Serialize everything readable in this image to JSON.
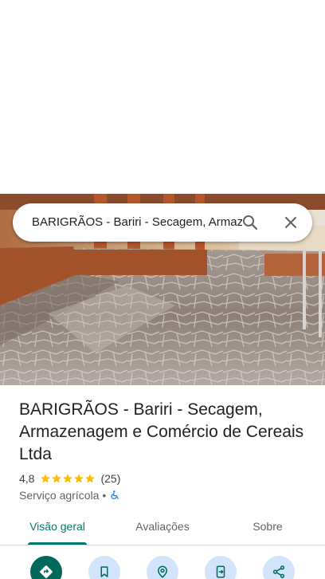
{
  "search": {
    "query": "BARIGRÃOS - Bariri - Secagem, Armazenagem e Comércio de Cereais Ltda"
  },
  "place": {
    "title": "BARIGRÃOS - Bariri - Secagem, Armazenagem e Comércio de Cereais Ltda",
    "rating": "4,8",
    "rating_value": 4.8,
    "stars_shown": 5,
    "review_count": "(25)",
    "category": "Serviço agrícola",
    "separator": "•"
  },
  "tabs": [
    {
      "label": "Visão geral",
      "active": true
    },
    {
      "label": "Avaliações",
      "active": false
    },
    {
      "label": "Sobre",
      "active": false
    }
  ],
  "actions": [
    {
      "icon": "directions-icon"
    },
    {
      "icon": "save-bookmark-icon"
    },
    {
      "icon": "nearby-icon"
    },
    {
      "icon": "send-to-phone-icon"
    },
    {
      "icon": "share-icon"
    }
  ],
  "colors": {
    "accent": "#00796b",
    "star": "#fbbc04",
    "action_bg": "#d2e3fc",
    "primary_action_bg": "#00695c",
    "accessibility": "#1a73e8"
  }
}
